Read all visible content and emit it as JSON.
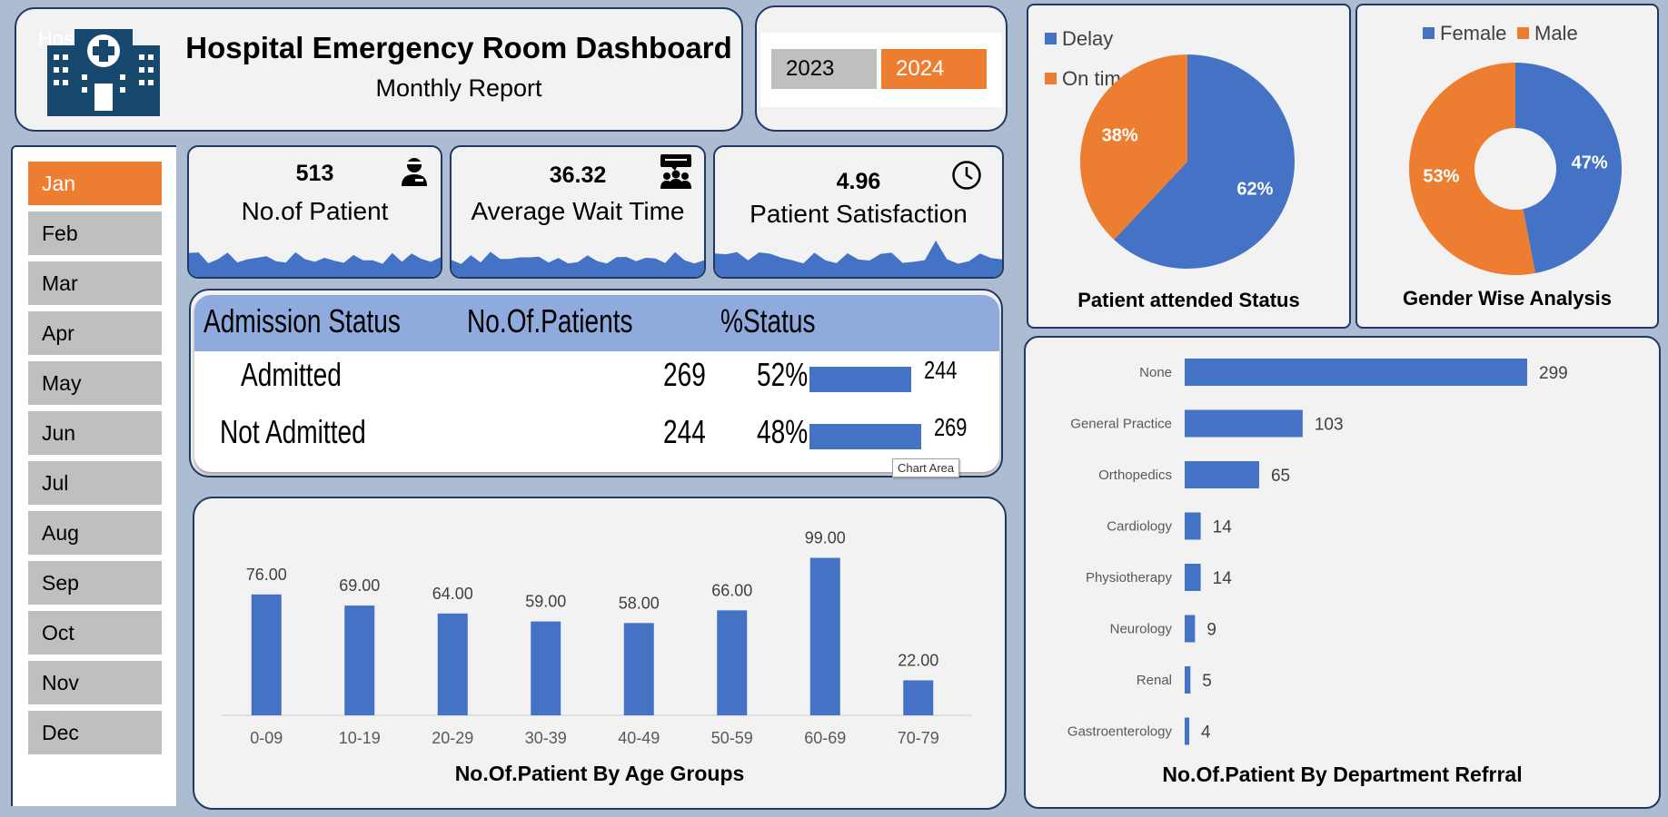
{
  "header": {
    "logo_fragment": "Hos",
    "title": "Hospital Emergency Room Dashboard",
    "subtitle": "Monthly Report"
  },
  "years": [
    {
      "label": "2023",
      "active": false
    },
    {
      "label": "2024",
      "active": true
    }
  ],
  "months": [
    {
      "label": "Jan",
      "active": true
    },
    {
      "label": "Feb",
      "active": false
    },
    {
      "label": "Mar",
      "active": false
    },
    {
      "label": "Apr",
      "active": false
    },
    {
      "label": "May",
      "active": false
    },
    {
      "label": "Jun",
      "active": false
    },
    {
      "label": "Jul",
      "active": false
    },
    {
      "label": "Aug",
      "active": false
    },
    {
      "label": "Sep",
      "active": false
    },
    {
      "label": "Oct",
      "active": false
    },
    {
      "label": "Nov",
      "active": false
    },
    {
      "label": "Dec",
      "active": false
    }
  ],
  "kpis": [
    {
      "value": "513",
      "label": "No.of Patient",
      "icon": "patient-icon"
    },
    {
      "value": "36.32",
      "label": "Average Wait Time",
      "icon": "waiting-group-icon"
    },
    {
      "value": "4.96",
      "label": "Patient Satisfaction",
      "icon": "clock-icon"
    }
  ],
  "admission": {
    "headers": [
      "Admission Status",
      "No.Of.Patients",
      "%Status"
    ],
    "rows": [
      {
        "status": "Admitted",
        "patients": "269",
        "percent": "52%",
        "bar_value": 244,
        "bar_label": "244"
      },
      {
        "status": "Not Admitted",
        "patients": "244",
        "percent": "48%",
        "bar_value": 269,
        "bar_label": "269"
      }
    ],
    "tooltip": "Chart Area"
  },
  "colors": {
    "blue": "#4472c4",
    "orange": "#ed7d31",
    "header_blue": "#8faadc",
    "navy": "#1f3864"
  },
  "chart_data": [
    {
      "type": "bar",
      "title": "No.Of.Patient By Age Groups",
      "categories": [
        "0-09",
        "10-19",
        "20-29",
        "30-39",
        "40-49",
        "50-59",
        "60-69",
        "70-79"
      ],
      "values": [
        76,
        69,
        64,
        59,
        58,
        66,
        99,
        22
      ],
      "data_labels": [
        "76.00",
        "69.00",
        "64.00",
        "59.00",
        "58.00",
        "66.00",
        "99.00",
        "22.00"
      ],
      "ylim": [
        0,
        105
      ]
    },
    {
      "type": "bar",
      "orientation": "horizontal",
      "title": "No.Of.Patient By Department Refrral",
      "categories": [
        "None",
        "General Practice",
        "Orthopedics",
        "Cardiology",
        "Physiotherapy",
        "Neurology",
        "Renal",
        "Gastroenterology"
      ],
      "values": [
        299,
        103,
        65,
        14,
        14,
        9,
        5,
        4
      ],
      "xlim": [
        0,
        299
      ]
    },
    {
      "type": "pie",
      "title": "Patient attended Status",
      "labels": [
        "Delay",
        "On time"
      ],
      "values": [
        62,
        38
      ],
      "slice_labels": [
        "62%",
        "38%"
      ],
      "legend": "top-left"
    },
    {
      "type": "pie",
      "donut": true,
      "title": "Gender Wise Analysis",
      "labels": [
        "Female",
        "Male"
      ],
      "values": [
        47,
        53
      ],
      "slice_labels": [
        "47%",
        "53%"
      ],
      "legend": "top"
    }
  ]
}
